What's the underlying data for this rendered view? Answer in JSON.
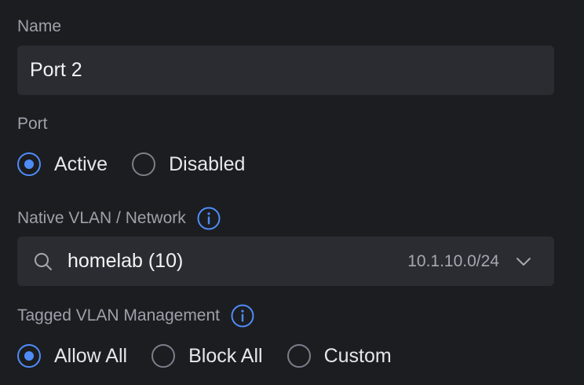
{
  "name_field": {
    "label": "Name",
    "value": "Port 2"
  },
  "port": {
    "label": "Port",
    "options": [
      {
        "label": "Active",
        "checked": true
      },
      {
        "label": "Disabled",
        "checked": false
      }
    ]
  },
  "native_vlan": {
    "label": "Native VLAN / Network",
    "info_icon": "info-icon",
    "search_icon": "search-icon",
    "selected_value": "homelab (10)",
    "subnet": "10.1.10.0/24",
    "dropdown_icon": "chevron-down-icon"
  },
  "tagged_vlan": {
    "label": "Tagged VLAN Management",
    "info_icon": "info-icon",
    "options": [
      {
        "label": "Allow All",
        "checked": true
      },
      {
        "label": "Block All",
        "checked": false
      },
      {
        "label": "Custom",
        "checked": false
      }
    ]
  },
  "colors": {
    "background": "#1c1d21",
    "field_background": "#2a2c31",
    "accent": "#4f8cf7",
    "label_text": "#9ea1aa",
    "primary_text": "#e9eaee"
  }
}
